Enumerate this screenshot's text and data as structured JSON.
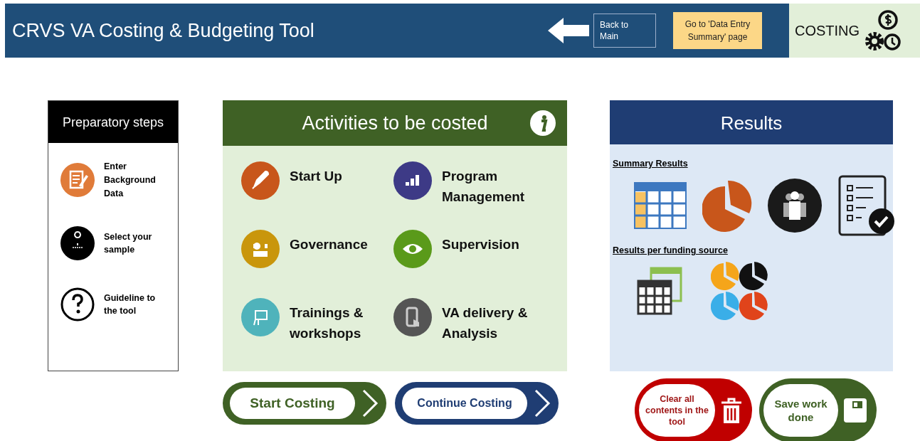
{
  "header": {
    "title": "CRVS VA Costing & Budgeting Tool",
    "back_button": "Back to Main",
    "summary_button": "Go to 'Data Entry Summary' page",
    "section_label": "COSTING"
  },
  "preparatory": {
    "title": "Preparatory steps",
    "steps": [
      {
        "label": "Enter Background Data"
      },
      {
        "label": "Select your sample"
      },
      {
        "label": "Guideline to the tool"
      }
    ]
  },
  "activities": {
    "title": "Activities to be costed",
    "items": [
      {
        "label": "Start Up",
        "color": "#c8561b"
      },
      {
        "label": "Program Management",
        "color": "#3d3a86"
      },
      {
        "label": "Governance",
        "color": "#c9960c"
      },
      {
        "label": "Supervision",
        "color": "#5a9a1a"
      },
      {
        "label": "Trainings & workshops",
        "color": "#4fb3bb"
      },
      {
        "label": "VA delivery & Analysis",
        "color": "#555555"
      }
    ]
  },
  "costing_buttons": [
    {
      "label": "Start Costing",
      "color": "#3f6125"
    },
    {
      "label": "Continue Costing",
      "color": "#1f3d73"
    }
  ],
  "results": {
    "title": "Results",
    "summary_heading": "Summary Results",
    "funding_heading": "Results per funding source"
  },
  "result_actions": [
    {
      "kind": "clear",
      "label": "Clear all contents in the tool",
      "color": "#c00000"
    },
    {
      "kind": "save",
      "label": "Save work done",
      "color": "#3f6125"
    }
  ]
}
